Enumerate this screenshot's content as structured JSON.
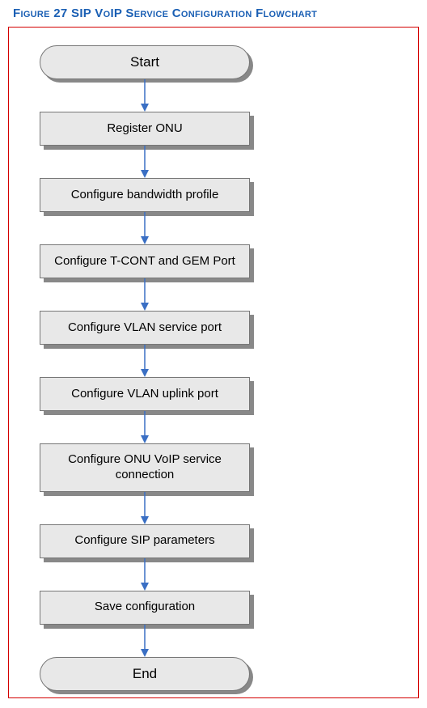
{
  "title": "Figure 27 SIP VoIP Service Configuration Flowchart",
  "flow": {
    "start": "Start",
    "end": "End",
    "steps": [
      "Register ONU",
      "Configure bandwidth profile",
      "Configure T-CONT and GEM Port",
      "Configure VLAN service port",
      "Configure VLAN uplink port",
      "Configure ONU VoIP service connection",
      "Configure SIP parameters",
      "Save configuration"
    ]
  },
  "colors": {
    "title": "#1a5fb4",
    "frame_border": "#d40000",
    "box_fill": "#e8e8e8",
    "box_border": "#777777",
    "arrow": "#3a6fc4"
  }
}
